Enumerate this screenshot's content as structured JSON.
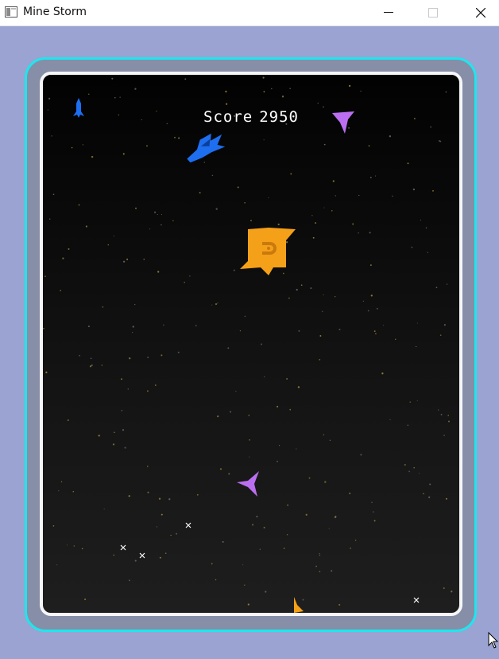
{
  "window": {
    "title": "Mine Storm",
    "app_icon": "window-app-icon",
    "controls": [
      "minimize-icon",
      "maximize-icon",
      "close-icon"
    ]
  },
  "colors": {
    "desktop_bg": "#9aa3d1",
    "frame_outer": "#1ee6ee",
    "frame_inner": "#f6f6f8",
    "player_ship": "#1e6ef0",
    "mine": "#f5a019",
    "minelayer": "#bb6ff0",
    "projectile": "#ffffff"
  },
  "hud": {
    "score_label": "Score",
    "score_value": "2950",
    "lives_remaining": 1
  }
}
